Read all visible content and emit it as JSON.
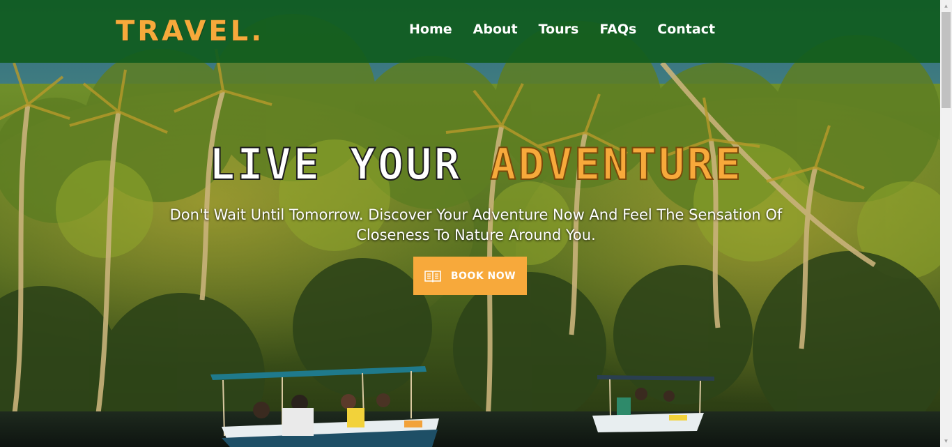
{
  "header": {
    "logo_text": "TRAVEL.",
    "nav": [
      "Home",
      "About",
      "Tours",
      "FAQs",
      "Contact"
    ]
  },
  "hero": {
    "headline_part1": "LIVE YOUR",
    "headline_part2": "ADVENTURE",
    "subtitle": "Don't Wait Until Tomorrow. Discover Your Adventure Now And Feel The Sensation Of Closeness To Nature Around You.",
    "cta_label": "BOOK NOW",
    "cta_icon": "book-icon"
  },
  "colors": {
    "navbar": "#105c1e",
    "accent": "#f7a93b",
    "text_light": "#ffffff"
  }
}
